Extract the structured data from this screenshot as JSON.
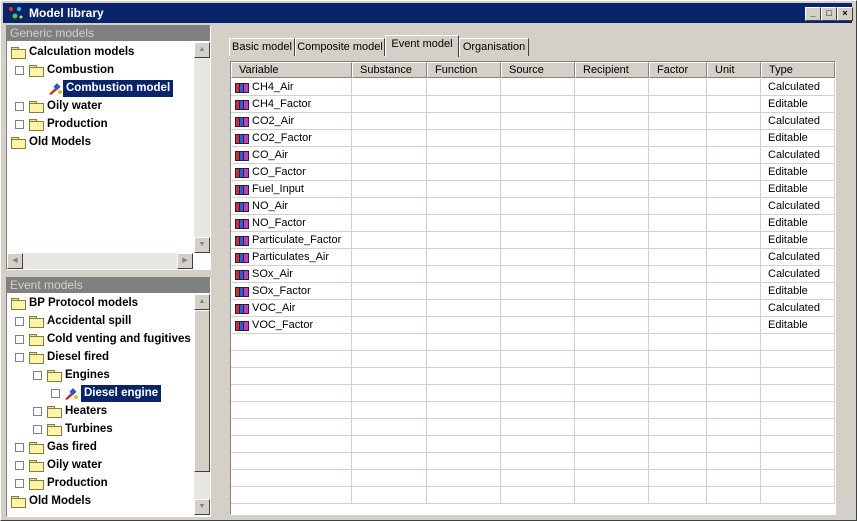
{
  "window": {
    "title": "Model library",
    "min": "_",
    "max": "□",
    "close": "×"
  },
  "generic_panel": {
    "header": "Generic models",
    "nodes": [
      {
        "label": "Calculation models",
        "expander": "−"
      },
      {
        "label": "Combustion",
        "expander": "−"
      },
      {
        "label": "Combustion model",
        "selected": true
      },
      {
        "label": "Oily water",
        "expander": "+"
      },
      {
        "label": "Production",
        "expander": "+"
      },
      {
        "label": "Old Models"
      }
    ]
  },
  "event_panel": {
    "header": "Event models",
    "nodes": [
      {
        "label": "BP Protocol models",
        "expander": "−"
      },
      {
        "label": "Accidental spill",
        "expander": "+"
      },
      {
        "label": "Cold venting and fugitives",
        "expander": "+"
      },
      {
        "label": "Diesel fired",
        "expander": "−"
      },
      {
        "label": "Engines",
        "expander": "−"
      },
      {
        "label": "Diesel engine",
        "expander": "+",
        "selected": true
      },
      {
        "label": "Heaters",
        "expander": "+"
      },
      {
        "label": "Turbines",
        "expander": "+"
      },
      {
        "label": "Gas fired",
        "expander": "+"
      },
      {
        "label": "Oily water",
        "expander": "+"
      },
      {
        "label": "Production",
        "expander": "+"
      },
      {
        "label": "Old Models"
      }
    ]
  },
  "tabs": [
    "Basic model",
    "Composite model",
    "Event model",
    "Organisation"
  ],
  "active_tab": "Event model",
  "table": {
    "columns": [
      "Variable",
      "Substance",
      "Function",
      "Source",
      "Recipient",
      "Factor",
      "Unit",
      "Type"
    ],
    "rows": [
      {
        "variable": "CH4_Air",
        "type": "Calculated"
      },
      {
        "variable": "CH4_Factor",
        "type": "Editable"
      },
      {
        "variable": "CO2_Air",
        "type": "Calculated"
      },
      {
        "variable": "CO2_Factor",
        "type": "Editable"
      },
      {
        "variable": "CO_Air",
        "type": "Calculated"
      },
      {
        "variable": "CO_Factor",
        "type": "Editable"
      },
      {
        "variable": "Fuel_Input",
        "type": "Editable"
      },
      {
        "variable": "NO_Air",
        "type": "Calculated"
      },
      {
        "variable": "NO_Factor",
        "type": "Editable"
      },
      {
        "variable": "Particulate_Factor",
        "type": "Editable"
      },
      {
        "variable": "Particulates_Air",
        "type": "Calculated"
      },
      {
        "variable": "SOx_Air",
        "type": "Calculated"
      },
      {
        "variable": "SOx_Factor",
        "type": "Editable"
      },
      {
        "variable": "VOC_Air",
        "type": "Calculated"
      },
      {
        "variable": "VOC_Factor",
        "type": "Editable"
      }
    ]
  },
  "icons": {
    "app": "model-library-icon",
    "folder": "folder-icon",
    "model": "model-icon",
    "variable": "variable-icon"
  },
  "colors": {
    "title_bar": "#0a246a",
    "selection": "#0a246a",
    "panel_header": "#808080"
  }
}
